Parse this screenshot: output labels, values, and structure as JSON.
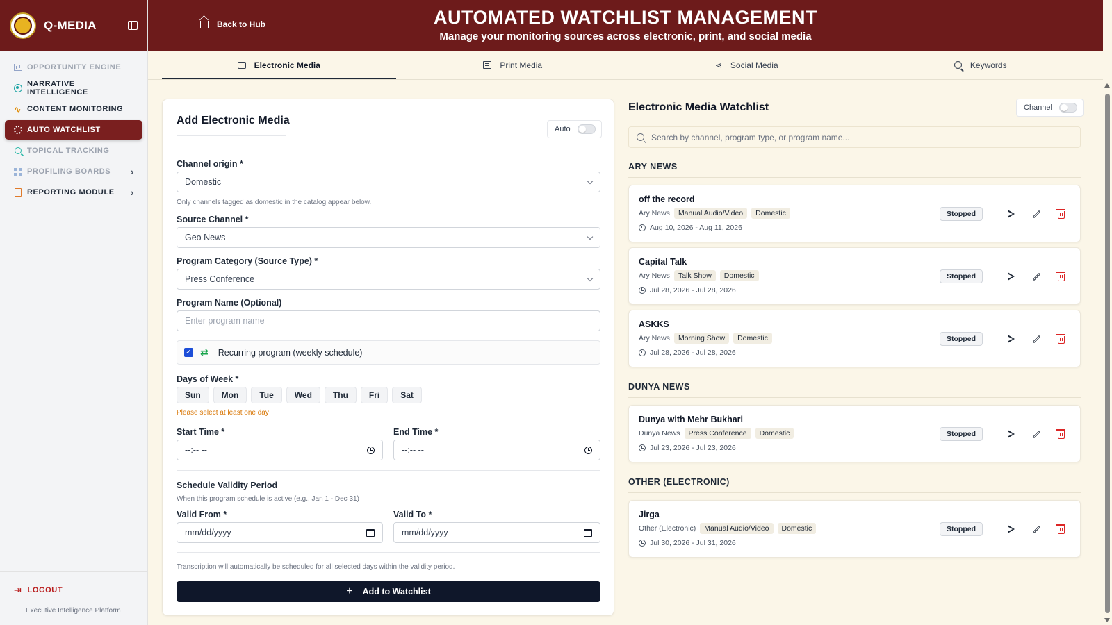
{
  "app": {
    "name": "Q-MEDIA",
    "footer": "Executive Intelligence Platform",
    "logout_label": "LOGOUT"
  },
  "sidebar": {
    "items": [
      {
        "label": "OPPORTUNITY ENGINE",
        "icon": "bar-chart-icon"
      },
      {
        "label": "NARRATIVE INTELLIGENCE",
        "icon": "target-icon"
      },
      {
        "label": "CONTENT MONITORING",
        "icon": "pulse-icon"
      },
      {
        "label": "AUTO WATCHLIST",
        "icon": "gear-icon",
        "active": true
      },
      {
        "label": "TOPICAL TRACKING",
        "icon": "search-icon"
      },
      {
        "label": "PROFILING BOARDS",
        "icon": "grid-icon",
        "chevron": "›"
      },
      {
        "label": "REPORTING MODULE",
        "icon": "document-icon",
        "chevron": "›"
      }
    ]
  },
  "header": {
    "back_label": "Back to Hub",
    "title": "AUTOMATED WATCHLIST MANAGEMENT",
    "subtitle": "Manage your monitoring sources across electronic, print, and social media"
  },
  "tabs": [
    {
      "label": "Electronic Media",
      "icon": "tv-icon",
      "active": true
    },
    {
      "label": "Print Media",
      "icon": "newspaper-icon"
    },
    {
      "label": "Social Media",
      "icon": "share-icon"
    },
    {
      "label": "Keywords",
      "icon": "search-icon"
    }
  ],
  "form": {
    "title": "Add Electronic Media",
    "auto_label": "Auto",
    "channel_origin": {
      "label": "Channel origin *",
      "value": "Domestic",
      "hint": "Only channels tagged as domestic in the catalog appear below."
    },
    "source_channel": {
      "label": "Source Channel *",
      "value": "Geo News"
    },
    "program_category": {
      "label": "Program Category (Source Type) *",
      "value": "Press Conference"
    },
    "program_name": {
      "label": "Program Name (Optional)",
      "placeholder": "Enter program name"
    },
    "recurring_label": "Recurring program (weekly schedule)",
    "days_label": "Days of Week *",
    "days": [
      "Sun",
      "Mon",
      "Tue",
      "Wed",
      "Thu",
      "Fri",
      "Sat"
    ],
    "days_warning": "Please select at least one day",
    "start_time": {
      "label": "Start Time *",
      "value": "--:-- --"
    },
    "end_time": {
      "label": "End Time *",
      "value": "--:-- --"
    },
    "validity": {
      "title": "Schedule Validity Period",
      "hint": "When this program schedule is active (e.g., Jan 1 - Dec 31)"
    },
    "valid_from": {
      "label": "Valid From *",
      "value": "mm/dd/yyyy"
    },
    "valid_to": {
      "label": "Valid To *",
      "value": "mm/dd/yyyy"
    },
    "footnote": "Transcription will automatically be scheduled for all selected days within the validity period.",
    "submit_label": "Add to Watchlist"
  },
  "watchlist": {
    "title": "Electronic Media Watchlist",
    "channel_toggle_label": "Channel",
    "search_placeholder": "Search by channel, program type, or program name...",
    "groups": [
      {
        "name": "ARY NEWS",
        "items": [
          {
            "name": "off the record",
            "channel": "Ary News",
            "type": "Manual Audio/Video",
            "origin": "Domestic",
            "dates": "Aug 10, 2026 - Aug 11, 2026",
            "status": "Stopped"
          },
          {
            "name": "Capital Talk",
            "channel": "Ary News",
            "type": "Talk Show",
            "origin": "Domestic",
            "dates": "Jul 28, 2026 - Jul 28, 2026",
            "status": "Stopped"
          },
          {
            "name": "ASKKS",
            "channel": "Ary News",
            "type": "Morning Show",
            "origin": "Domestic",
            "dates": "Jul 28, 2026 - Jul 28, 2026",
            "status": "Stopped"
          }
        ]
      },
      {
        "name": "DUNYA NEWS",
        "items": [
          {
            "name": "Dunya with Mehr Bukhari",
            "channel": "Dunya News",
            "type": "Press Conference",
            "origin": "Domestic",
            "dates": "Jul 23, 2026 - Jul 23, 2026",
            "status": "Stopped"
          }
        ]
      },
      {
        "name": "OTHER (ELECTRONIC)",
        "items": [
          {
            "name": "Jirga",
            "channel": "Other (Electronic)",
            "type": "Manual Audio/Video",
            "origin": "Domestic",
            "dates": "Jul 30, 2026 - Jul 31, 2026",
            "status": "Stopped"
          }
        ]
      }
    ]
  }
}
